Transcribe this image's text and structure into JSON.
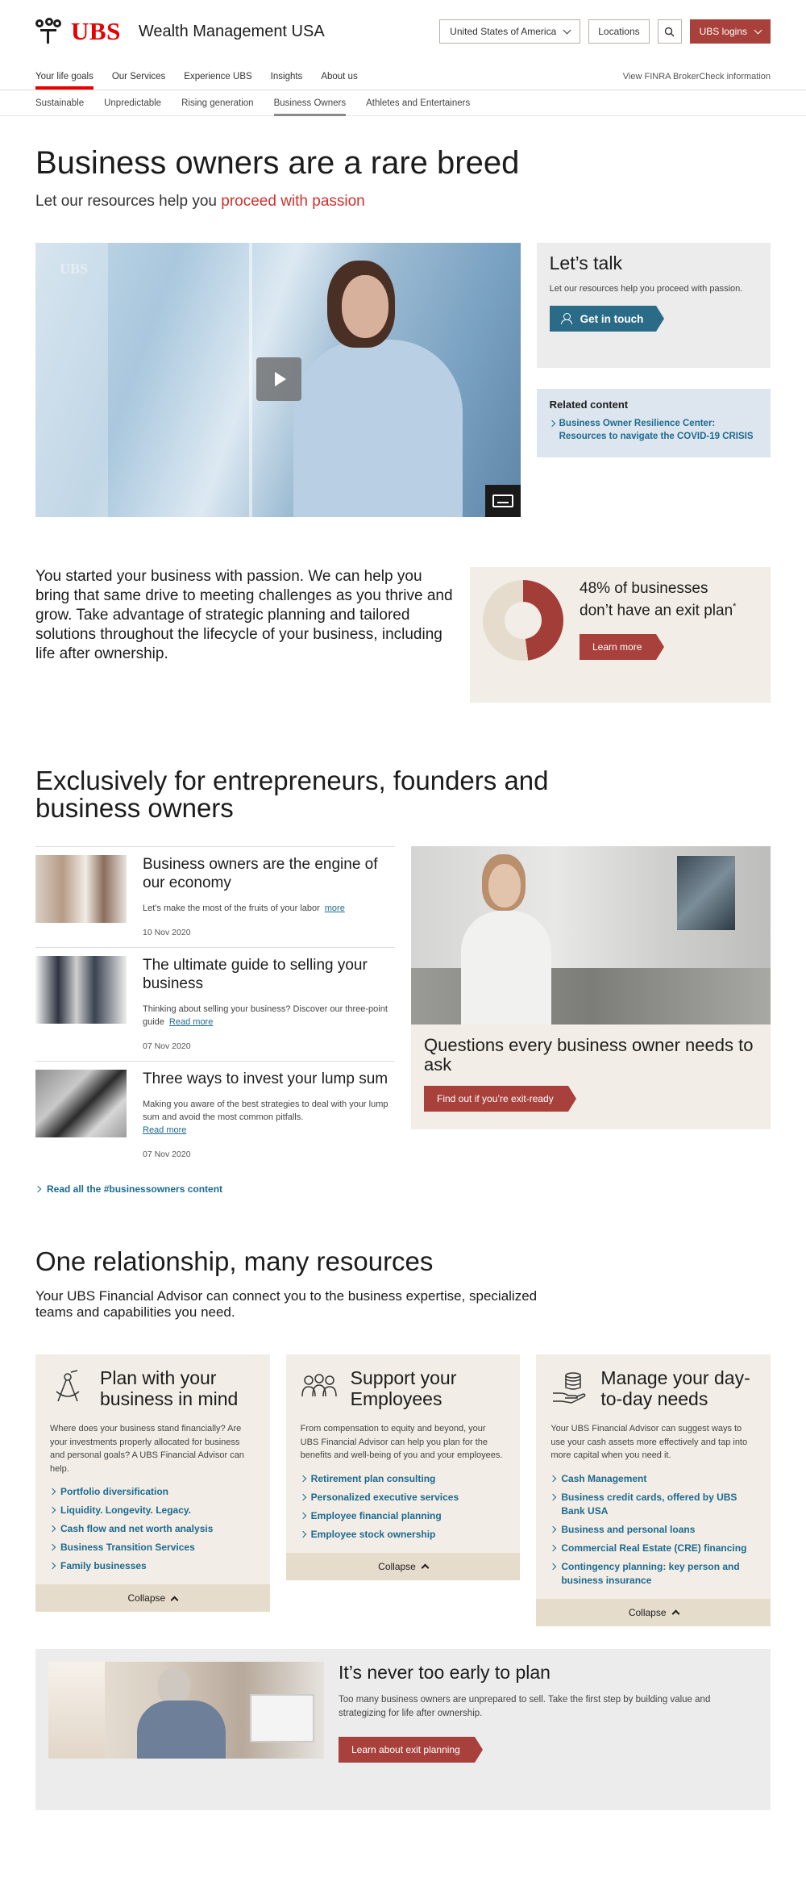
{
  "header": {
    "logo_text": "UBS",
    "site_title": "Wealth Management USA",
    "country_select": "United States of America",
    "locations_label": "Locations",
    "logins_label": "UBS logins"
  },
  "nav": {
    "items": [
      "Your life goals",
      "Our Services",
      "Experience UBS",
      "Insights",
      "About us"
    ],
    "finra_link": "View FINRA BrokerCheck information"
  },
  "subnav": {
    "items": [
      "Sustainable",
      "Unpredictable",
      "Rising generation",
      "Business Owners",
      "Athletes and Entertainers"
    ]
  },
  "hero": {
    "title": "Business owners are a rare breed",
    "subtitle_lead": "Let our resources help you ",
    "subtitle_highlight": "proceed with passion"
  },
  "talk": {
    "title": "Let’s talk",
    "text": "Let our resources help you proceed with passion.",
    "button": "Get in touch"
  },
  "related": {
    "heading": "Related content",
    "link": "Business Owner Resilience Center: Resources to navigate the COVID-19 CRISIS"
  },
  "passion": {
    "text": "You started your business with passion. We can help you bring that same drive to meeting challenges as you thrive and grow. Take advantage of strategic planning and tailored solutions throughout the lifecycle of your business, including life after ownership."
  },
  "stat": {
    "percent": 48,
    "text": "48% of businesses don’t have an exit plan",
    "footnote": "*",
    "button": "Learn more",
    "colors": {
      "filled": "#a33d38",
      "empty": "#e5dccd"
    }
  },
  "exclusive": {
    "title": "Exclusively for entrepreneurs, founders and business owners",
    "articles": [
      {
        "title": "Business owners are the engine of our economy",
        "desc": "Let's make the most of the fruits of your labor",
        "link": "more",
        "date": "10 Nov 2020"
      },
      {
        "title": "The ultimate guide to selling your business",
        "desc": "Thinking about selling your business? Discover our three-point guide",
        "link": "Read more",
        "date": "07 Nov 2020"
      },
      {
        "title": "Three ways to invest your lump sum",
        "desc": "Making you aware of the best strategies to deal with your lump sum and avoid the most common pitfalls.",
        "link": "Read more",
        "date": "07 Nov 2020"
      }
    ],
    "feature_title": "Questions every business owner needs to ask",
    "feature_button": "Find out if you’re exit-ready",
    "read_all": "Read all the #businessowners content"
  },
  "resources": {
    "title": "One relationship, many resources",
    "lead": "Your UBS Financial Advisor can connect you to the business expertise, specialized teams and capabilities you need.",
    "collapse_label": "Collapse",
    "cards": [
      {
        "title": "Plan with your business in mind",
        "icon": "compass-icon",
        "desc": "Where does your business stand financially? Are your investments properly allocated for business and personal goals? A UBS Financial Advisor can help.",
        "links": [
          "Portfolio diversification",
          "Liquidity. Longevity. Legacy.",
          "Cash flow and net worth analysis",
          "Business Transition Services",
          "Family businesses"
        ]
      },
      {
        "title": "Support your Employees",
        "icon": "people-icon",
        "desc": "From compensation to equity and beyond, your UBS Financial Advisor can help you plan for the benefits and well-being of you and your employees.",
        "links": [
          "Retirement plan consulting",
          "Personalized executive services",
          "Employee financial planning",
          "Employee stock ownership"
        ]
      },
      {
        "title": "Manage your day-to-day needs",
        "icon": "coins-hand-icon",
        "desc": "Your UBS Financial Advisor can suggest ways to use your cash assets more effectively and tap into more capital when you need it.",
        "links": [
          "Cash Management",
          "Business credit cards, offered by UBS Bank USA",
          "Business and personal loans",
          "Commercial Real Estate (CRE) financing",
          "Contingency planning: key person and business insurance"
        ]
      }
    ]
  },
  "plan": {
    "title": "It’s never too early to plan",
    "text": "Too many business owners are unprepared to sell. Take the first step by building value and strategizing for life after ownership.",
    "button": "Learn about exit planning"
  }
}
